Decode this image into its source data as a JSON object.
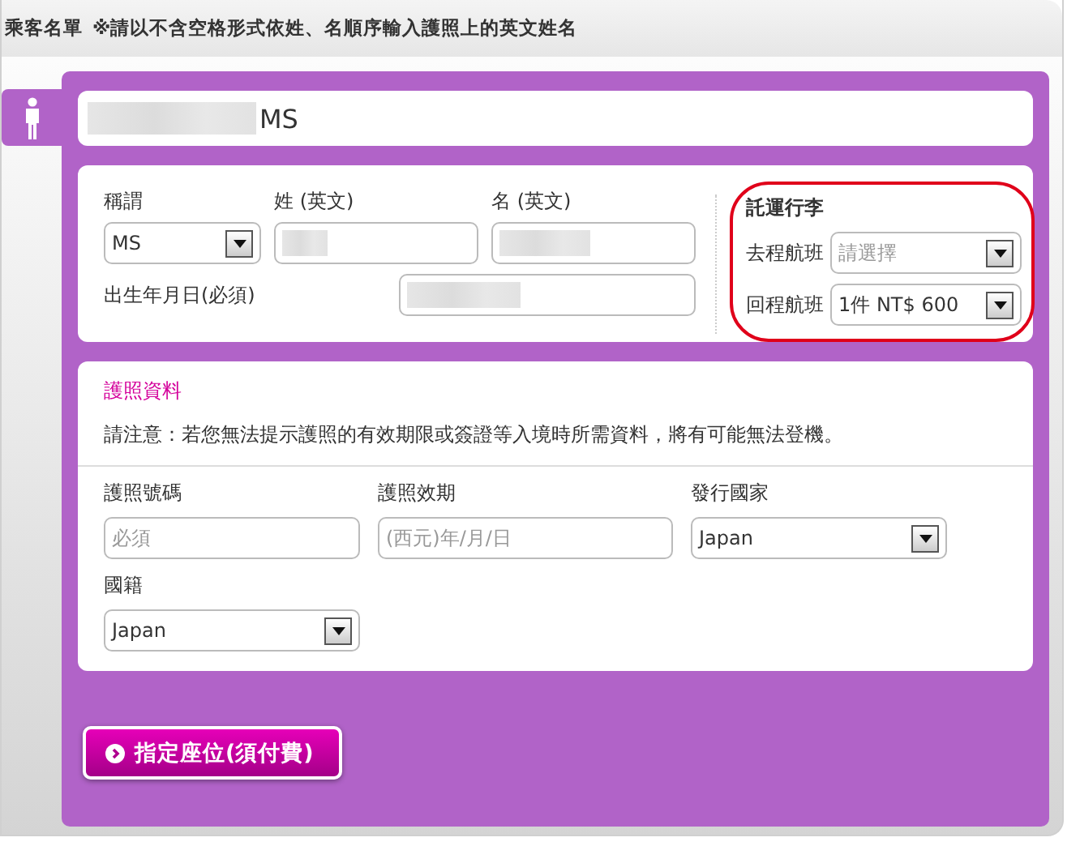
{
  "header": {
    "title": "乘客名單",
    "note": "※請以不含空格形式依姓、名順序輸入護照上的英文姓名"
  },
  "passenger": {
    "name_redacted": true,
    "name_suffix": "MS"
  },
  "name_fields": {
    "title": {
      "label": "稱謂",
      "value": "MS"
    },
    "surname": {
      "label": "姓 (英文)",
      "redacted": true
    },
    "given_name": {
      "label": "名 (英文)",
      "redacted": true
    },
    "birth_date": {
      "label": "出生年月日(必須)",
      "redacted": true
    }
  },
  "baggage": {
    "title": "託運行李",
    "highlighted": true,
    "outbound": {
      "label": "去程航班",
      "placeholder": "請選擇"
    },
    "return": {
      "label": "回程航班",
      "value": "1件 NT$ 600"
    }
  },
  "passport": {
    "title": "護照資料",
    "notice": "請注意：若您無法提示護照的有效期限或簽證等入境時所需資料，將有可能無法登機。",
    "fields": [
      {
        "kind": "input",
        "label": "護照號碼",
        "placeholder": "必須"
      },
      {
        "kind": "input",
        "label": "護照效期",
        "placeholder": "(西元)年/月/日"
      },
      {
        "kind": "select",
        "label": "發行國家",
        "value": "Japan"
      },
      {
        "kind": "select",
        "label": "國籍",
        "value": "Japan"
      }
    ]
  },
  "seat_button": "指定座位(須付費)"
}
